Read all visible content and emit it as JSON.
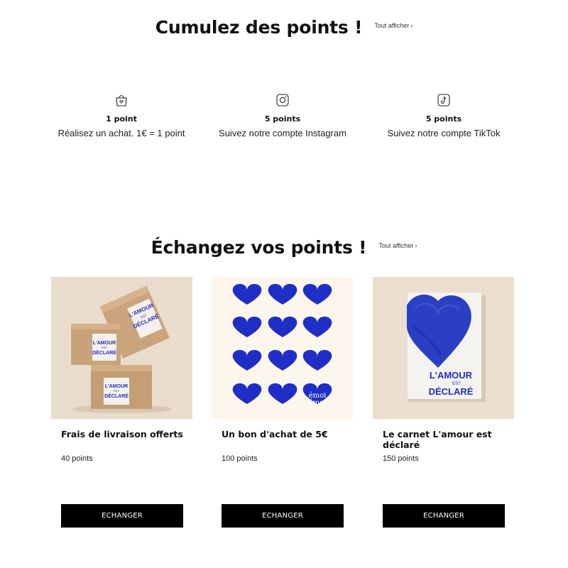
{
  "earn": {
    "title": "Cumulez des points !",
    "see_all": "Tout afficher",
    "items": [
      {
        "icon": "shopping-bag-icon",
        "points": "1 point",
        "description": "Réalisez un achat. 1€ = 1 point"
      },
      {
        "icon": "instagram-icon",
        "points": "5 points",
        "description": "Suivez notre compte Instagram"
      },
      {
        "icon": "tiktok-icon",
        "points": "5 points",
        "description": "Suivez notre compte TikTok"
      }
    ]
  },
  "redeem": {
    "title": "Échangez vos points !",
    "see_all": "Tout afficher",
    "cards": [
      {
        "title": "Frais de livraison offerts",
        "points": "40 points",
        "button": "ECHANGER",
        "image_text": [
          "L'AMOUR",
          "EST",
          "DÉCLARÉ"
        ]
      },
      {
        "title": "Un bon d'achat de 5€",
        "points": "100 points",
        "button": "ECHANGER",
        "image_text": [
          "émoi",
          "émoi"
        ]
      },
      {
        "title": "Le carnet L'amour est déclaré",
        "points": "150 points",
        "button": "ECHANGER",
        "image_text": [
          "L'AMOUR",
          "EST",
          "DÉCLARÉ"
        ]
      }
    ]
  },
  "colors": {
    "accent_blue": "#1f2ec6",
    "button_bg": "#000000",
    "beige": "#e8d9c8",
    "cream": "#fbf5ec"
  }
}
